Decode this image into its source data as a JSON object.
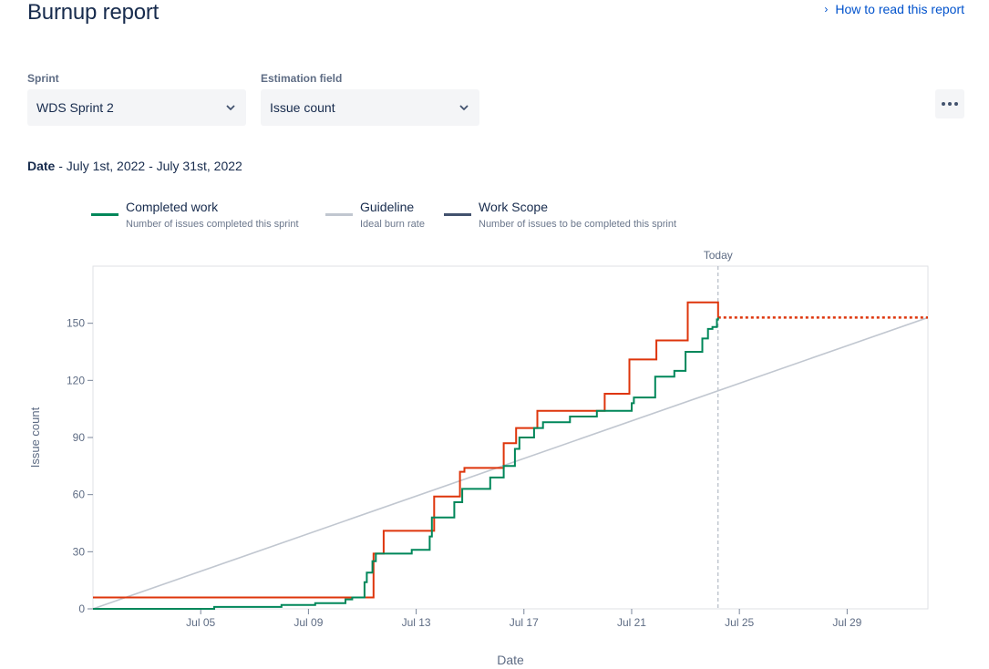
{
  "header": {
    "title": "Burnup report",
    "help_link": "How to read this report"
  },
  "filters": {
    "sprint_label": "Sprint",
    "sprint_value": "WDS Sprint 2",
    "estimation_label": "Estimation field",
    "estimation_value": "Issue count"
  },
  "date_range": {
    "label": "Date",
    "value": " - July 1st, 2022 - July 31st, 2022"
  },
  "legend": [
    {
      "title": "Completed work",
      "subtitle": "Number of issues completed this sprint",
      "color": "#00875A"
    },
    {
      "title": "Guideline",
      "subtitle": "Ideal burn rate",
      "color": "#C1C7D0"
    },
    {
      "title": "Work Scope",
      "subtitle": "Number of issues to be completed this sprint",
      "color": "#42526E"
    }
  ],
  "chart_data": {
    "type": "line",
    "xlabel": "Date",
    "ylabel": "Issue count",
    "today_label": "Today",
    "x_range": [
      "2022-07-01",
      "2022-08-01"
    ],
    "ylim": [
      0,
      180
    ],
    "yticks": [
      0,
      30,
      60,
      90,
      120,
      150
    ],
    "xticks": [
      {
        "date": "2022-07-05",
        "label": "Jul 05"
      },
      {
        "date": "2022-07-09",
        "label": "Jul 09"
      },
      {
        "date": "2022-07-13",
        "label": "Jul 13"
      },
      {
        "date": "2022-07-17",
        "label": "Jul 17"
      },
      {
        "date": "2022-07-21",
        "label": "Jul 21"
      },
      {
        "date": "2022-07-25",
        "label": "Jul 25"
      },
      {
        "date": "2022-07-29",
        "label": "Jul 29"
      }
    ],
    "today": "2022-07-24 5:00",
    "colors": {
      "completed": "#00875A",
      "guideline": "#C1C7D0",
      "scope": "#DE350B",
      "today_line": "#A5ADBA"
    },
    "series": [
      {
        "name": "Completed work",
        "step": true,
        "points": [
          [
            "2022-07-01 0:00",
            0
          ],
          [
            "2022-07-05 12:00",
            1
          ],
          [
            "2022-07-08 0:00",
            2
          ],
          [
            "2022-07-09 6:00",
            3
          ],
          [
            "2022-07-10 9:00",
            5
          ],
          [
            "2022-07-10 15:00",
            6
          ],
          [
            "2022-07-11 2:00",
            14
          ],
          [
            "2022-07-11 4:00",
            19
          ],
          [
            "2022-07-11 9:00",
            25
          ],
          [
            "2022-07-11 12:00",
            29
          ],
          [
            "2022-07-12 20:00",
            31
          ],
          [
            "2022-07-13 12:00",
            38
          ],
          [
            "2022-07-13 14:00",
            48
          ],
          [
            "2022-07-14 10:00",
            56
          ],
          [
            "2022-07-14 17:00",
            63
          ],
          [
            "2022-07-15 18:00",
            69
          ],
          [
            "2022-07-16 6:00",
            75
          ],
          [
            "2022-07-16 16:00",
            84
          ],
          [
            "2022-07-16 20:00",
            90
          ],
          [
            "2022-07-17 9:00",
            95
          ],
          [
            "2022-07-17 17:00",
            98
          ],
          [
            "2022-07-18 17:00",
            101
          ],
          [
            "2022-07-19 17:00",
            104
          ],
          [
            "2022-07-21 0:00",
            108
          ],
          [
            "2022-07-21 2:00",
            111
          ],
          [
            "2022-07-21 21:00",
            122
          ],
          [
            "2022-07-22 14:00",
            125
          ],
          [
            "2022-07-23 0:00",
            135
          ],
          [
            "2022-07-23 15:00",
            142
          ],
          [
            "2022-07-23 20:00",
            147
          ],
          [
            "2022-07-24 0:00",
            148
          ],
          [
            "2022-07-24 4:00",
            152
          ],
          [
            "2022-07-24 5:00",
            153
          ]
        ]
      },
      {
        "name": "Guideline",
        "step": false,
        "points": [
          [
            "2022-07-01 0:00",
            0
          ],
          [
            "2022-08-01 0:00",
            153
          ]
        ]
      },
      {
        "name": "Work Scope",
        "step": true,
        "points": [
          [
            "2022-07-01 0:00",
            6
          ],
          [
            "2022-07-11 10:00",
            29
          ],
          [
            "2022-07-11 19:00",
            41
          ],
          [
            "2022-07-13 16:00",
            59
          ],
          [
            "2022-07-14 15:00",
            72
          ],
          [
            "2022-07-14 19:00",
            74
          ],
          [
            "2022-07-16 6:00",
            87
          ],
          [
            "2022-07-16 17:00",
            95
          ],
          [
            "2022-07-17 12:00",
            104
          ],
          [
            "2022-07-20 0:00",
            113
          ],
          [
            "2022-07-20 22:00",
            131
          ],
          [
            "2022-07-21 22:00",
            141
          ],
          [
            "2022-07-23 2:00",
            161
          ],
          [
            "2022-07-24 5:00",
            153
          ]
        ],
        "projection": [
          [
            "2022-07-24 5:00",
            153
          ],
          [
            "2022-08-01 0:00",
            153
          ]
        ]
      }
    ]
  }
}
